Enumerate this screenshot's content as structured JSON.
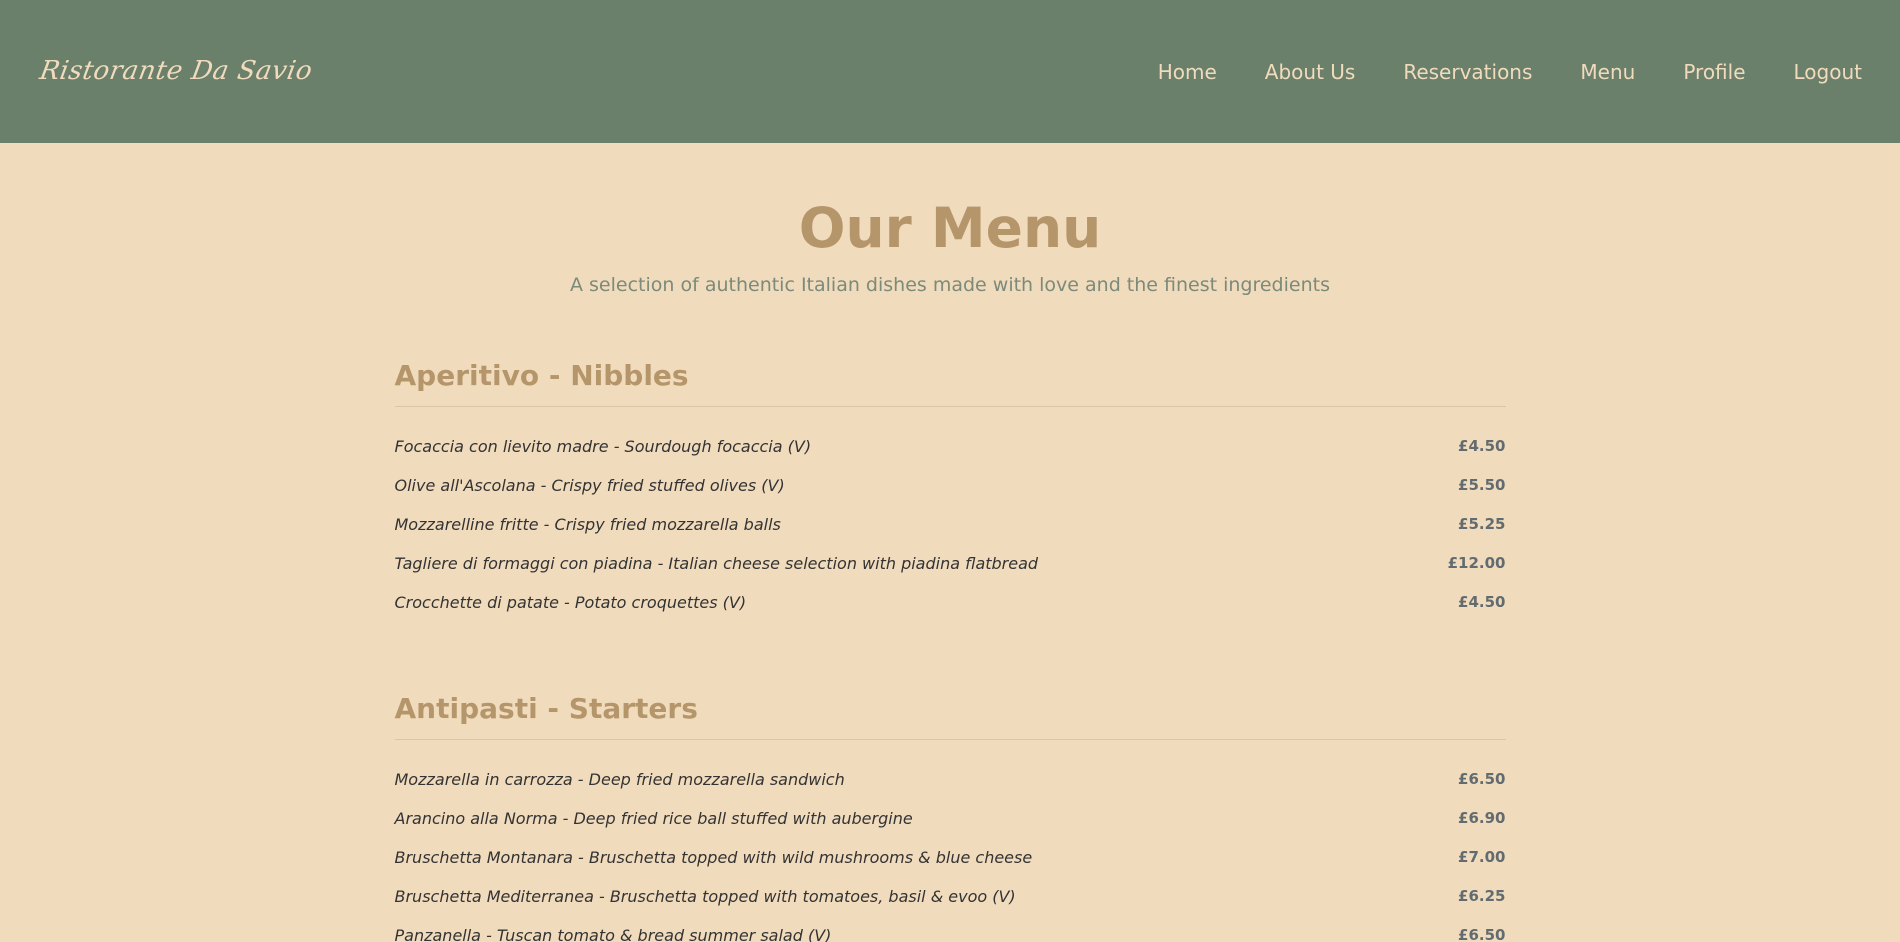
{
  "brand": "Ristorante Da Savio",
  "nav": [
    "Home",
    "About Us",
    "Reservations",
    "Menu",
    "Profile",
    "Logout"
  ],
  "page": {
    "title": "Our Menu",
    "subtitle": "A selection of authentic Italian dishes made with love and the finest ingredients"
  },
  "sections": [
    {
      "title": "Aperitivo - Nibbles",
      "items": [
        {
          "name": "Focaccia con lievito madre - Sourdough focaccia (V)",
          "price": "£4.50"
        },
        {
          "name": "Olive all'Ascolana - Crispy fried stuffed olives (V)",
          "price": "£5.50"
        },
        {
          "name": "Mozzarelline fritte - Crispy fried mozzarella balls",
          "price": "£5.25"
        },
        {
          "name": "Tagliere di formaggi con piadina - Italian cheese selection with piadina flatbread",
          "price": "£12.00"
        },
        {
          "name": "Crocchette di patate - Potato croquettes (V)",
          "price": "£4.50"
        }
      ]
    },
    {
      "title": "Antipasti - Starters",
      "items": [
        {
          "name": "Mozzarella in carrozza - Deep fried mozzarella sandwich",
          "price": "£6.50"
        },
        {
          "name": "Arancino alla Norma - Deep fried rice ball stuffed with aubergine",
          "price": "£6.90"
        },
        {
          "name": "Bruschetta Montanara - Bruschetta topped with wild mushrooms & blue cheese",
          "price": "£7.00"
        },
        {
          "name": "Bruschetta Mediterranea - Bruschetta topped with tomatoes, basil & evoo (V)",
          "price": "£6.25"
        },
        {
          "name": "Panzanella - Tuscan tomato & bread summer salad (V)",
          "price": "£6.50"
        }
      ]
    }
  ]
}
